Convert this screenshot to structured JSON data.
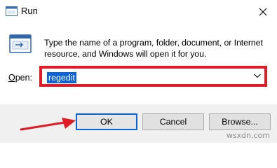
{
  "window": {
    "title": "Run",
    "close_icon": "close-icon",
    "app_icon": "run-icon"
  },
  "content": {
    "description": "Type the name of a program, folder, document, or Internet resource, and Windows will open it for you.",
    "open_label_first": "O",
    "open_label_rest": "pen:",
    "open_value": "regedit",
    "highlight_color": "#e01b25",
    "selection_color": "#0a64d8"
  },
  "buttons": {
    "ok": "OK",
    "cancel": "Cancel",
    "browse": "Browse..."
  },
  "watermark": "wsxdn.com"
}
